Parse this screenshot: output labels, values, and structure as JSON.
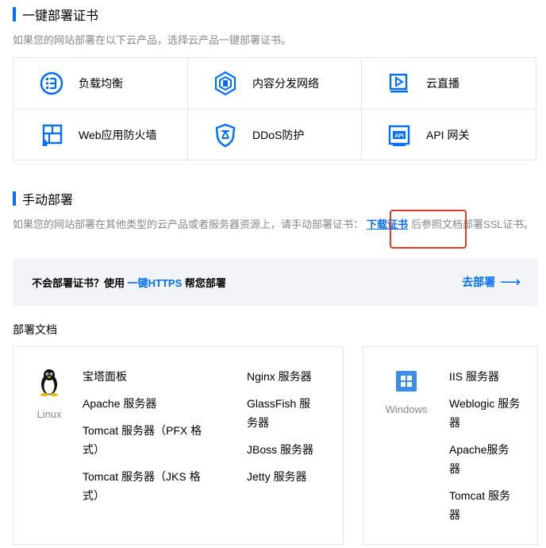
{
  "one_click": {
    "title": "一键部署证书",
    "desc": "如果您的网站部署在以下云产品，选择云产品一键部署证书。",
    "products": [
      {
        "label": "负载均衡",
        "icon": "load-balancer-icon"
      },
      {
        "label": "内容分发网络",
        "icon": "cdn-icon"
      },
      {
        "label": "云直播",
        "icon": "live-stream-icon"
      },
      {
        "label": "Web应用防火墙",
        "icon": "waf-icon"
      },
      {
        "label": "DDoS防护",
        "icon": "ddos-shield-icon"
      },
      {
        "label": "API 网关",
        "icon": "api-gateway-icon"
      }
    ]
  },
  "manual": {
    "title": "手动部署",
    "desc_before": "如果您的网站部署在其他类型的云产品或者服务器资源上，请手动部署证书：",
    "download_link": "下载证书",
    "desc_after": "后参照文档部署SSL证书。"
  },
  "banner": {
    "question_before": "不会部署证书？使用 ",
    "link": "一键HTTPS",
    "question_after": " 帮您部署",
    "go_label": "去部署",
    "go_arrow": "⟶"
  },
  "docs": {
    "title": "部署文档",
    "linux": {
      "os_name": "Linux",
      "col1": [
        "宝塔面板",
        "Apache 服务器",
        "Tomcat 服务器（PFX 格式）",
        "Tomcat 服务器（JKS 格式）"
      ],
      "col2": [
        "Nginx 服务器",
        "GlassFish 服务器",
        "JBoss 服务器",
        "Jetty 服务器"
      ]
    },
    "windows": {
      "os_name": "Windows",
      "col1": [
        "IIS 服务器",
        "Weblogic 服务器",
        "Apache服务器",
        "Tomcat 服务器"
      ]
    }
  },
  "colors": {
    "accent": "#006eff",
    "highlight": "#e03b2b",
    "muted": "#888888"
  }
}
